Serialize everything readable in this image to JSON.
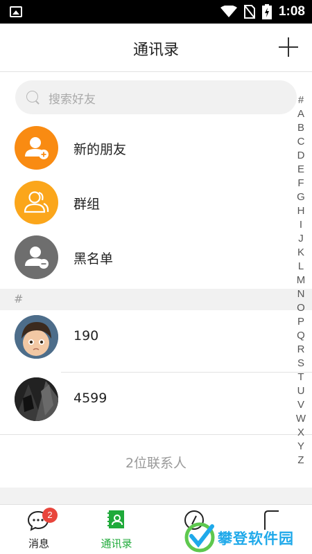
{
  "status_bar": {
    "time": "1:08"
  },
  "header": {
    "title": "通讯录",
    "add_icon": "plus-icon"
  },
  "search": {
    "placeholder": "搜索好友"
  },
  "quick_entries": [
    {
      "label": "新的朋友",
      "icon": "add-friend-icon",
      "color": "#f98b12"
    },
    {
      "label": "群组",
      "icon": "group-icon",
      "color": "#fba61b"
    },
    {
      "label": "黑名单",
      "icon": "blocklist-icon",
      "color": "#6e6e6e"
    }
  ],
  "section": {
    "header": "#"
  },
  "contacts": [
    {
      "name": "190"
    },
    {
      "name": "4599"
    }
  ],
  "contact_count": "2位联系人",
  "alphabet_index": [
    "#",
    "A",
    "B",
    "C",
    "D",
    "E",
    "F",
    "G",
    "H",
    "I",
    "J",
    "K",
    "L",
    "M",
    "N",
    "O",
    "P",
    "Q",
    "R",
    "S",
    "T",
    "U",
    "V",
    "W",
    "X",
    "Y",
    "Z"
  ],
  "bottom_nav": {
    "tabs": [
      {
        "label": "消息",
        "icon": "chat-icon",
        "badge": "2"
      },
      {
        "label": "通讯录",
        "icon": "contacts-icon",
        "active": true
      },
      {
        "label": "",
        "icon": "discover-icon"
      },
      {
        "label": "",
        "icon": "me-icon"
      }
    ],
    "active_color": "#1faa3a"
  },
  "watermark": {
    "text": "攀登软件园"
  }
}
